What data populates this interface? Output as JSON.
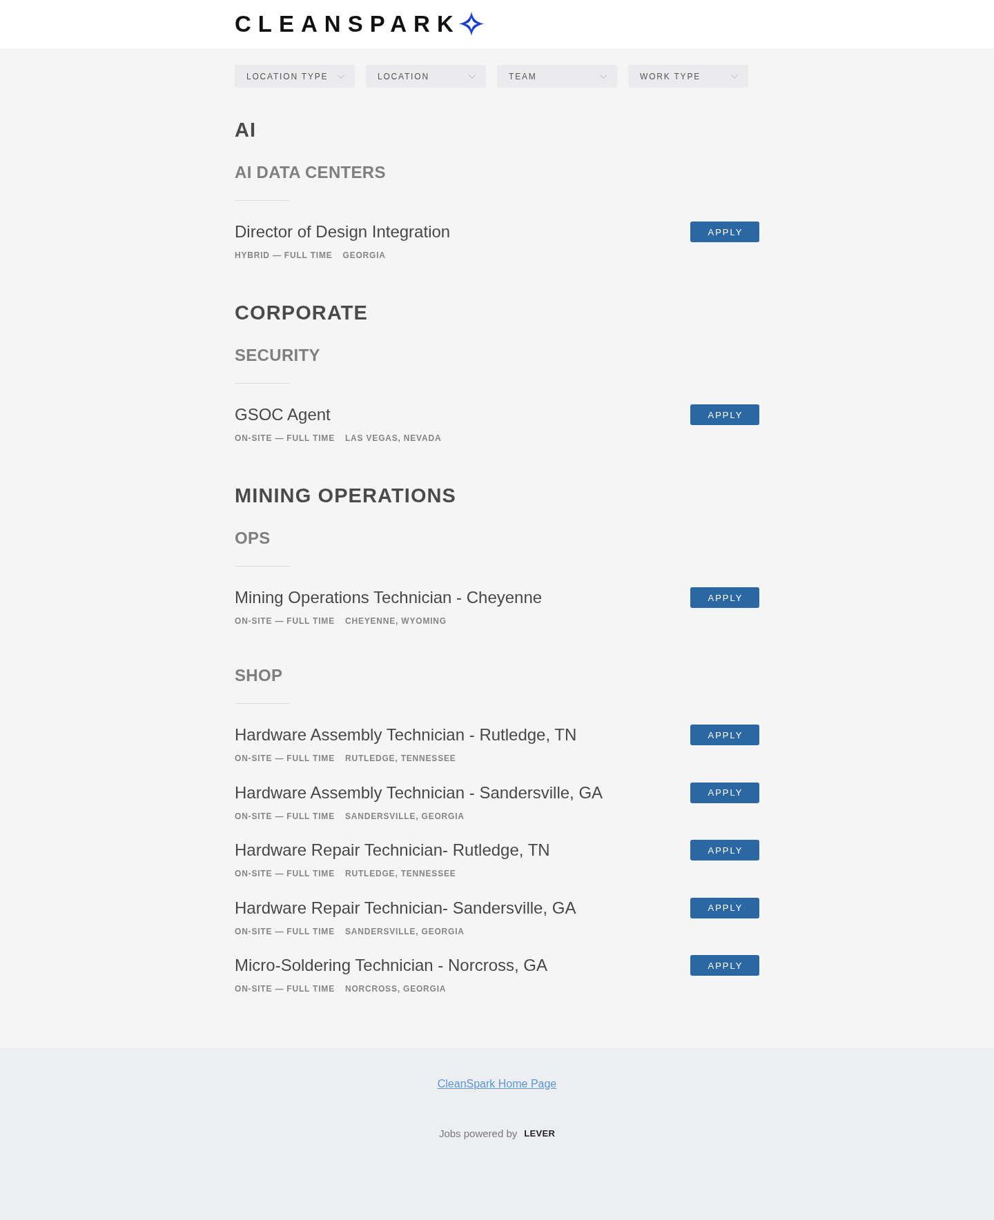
{
  "header": {
    "logo_text": "CLEANSPARK"
  },
  "filters": [
    {
      "label": "LOCATION TYPE"
    },
    {
      "label": "LOCATION"
    },
    {
      "label": "TEAM"
    },
    {
      "label": "WORK TYPE"
    }
  ],
  "groups": [
    {
      "title": "AI",
      "teams": [
        {
          "title": "AI DATA CENTERS",
          "postings": [
            {
              "title": "Director of Design Integration",
              "commitment": "HYBRID — FULL TIME",
              "location": "GEORGIA",
              "button": "APPLY"
            }
          ]
        }
      ]
    },
    {
      "title": "CORPORATE",
      "teams": [
        {
          "title": "SECURITY",
          "postings": [
            {
              "title": "GSOC Agent",
              "commitment": "ON-SITE — FULL TIME",
              "location": "LAS VEGAS, NEVADA",
              "button": "APPLY"
            }
          ]
        }
      ]
    },
    {
      "title": "MINING OPERATIONS",
      "teams": [
        {
          "title": "OPS",
          "postings": [
            {
              "title": "Mining Operations Technician - Cheyenne",
              "commitment": "ON-SITE — FULL TIME",
              "location": "CHEYENNE, WYOMING",
              "button": "APPLY"
            }
          ]
        },
        {
          "title": "SHOP",
          "postings": [
            {
              "title": "Hardware Assembly Technician - Rutledge, TN",
              "commitment": "ON-SITE — FULL TIME",
              "location": "RUTLEDGE, TENNESSEE",
              "button": "APPLY"
            },
            {
              "title": "Hardware Assembly Technician - Sandersville, GA",
              "commitment": "ON-SITE — FULL TIME",
              "location": "SANDERSVILLE, GEORGIA",
              "button": "APPLY"
            },
            {
              "title": "Hardware Repair Technician- Rutledge, TN",
              "commitment": "ON-SITE — FULL TIME",
              "location": "RUTLEDGE, TENNESSEE",
              "button": "APPLY"
            },
            {
              "title": "Hardware Repair Technician- Sandersville, GA",
              "commitment": "ON-SITE — FULL TIME",
              "location": "SANDERSVILLE, GEORGIA",
              "button": "APPLY"
            },
            {
              "title": "Micro-Soldering Technician - Norcross, GA",
              "commitment": "ON-SITE — FULL TIME",
              "location": "NORCROSS, GEORGIA",
              "button": "APPLY"
            }
          ]
        }
      ]
    }
  ],
  "footer": {
    "link": "CleanSpark Home Page",
    "powered_by": "Jobs powered by",
    "brand": "LEVER"
  }
}
